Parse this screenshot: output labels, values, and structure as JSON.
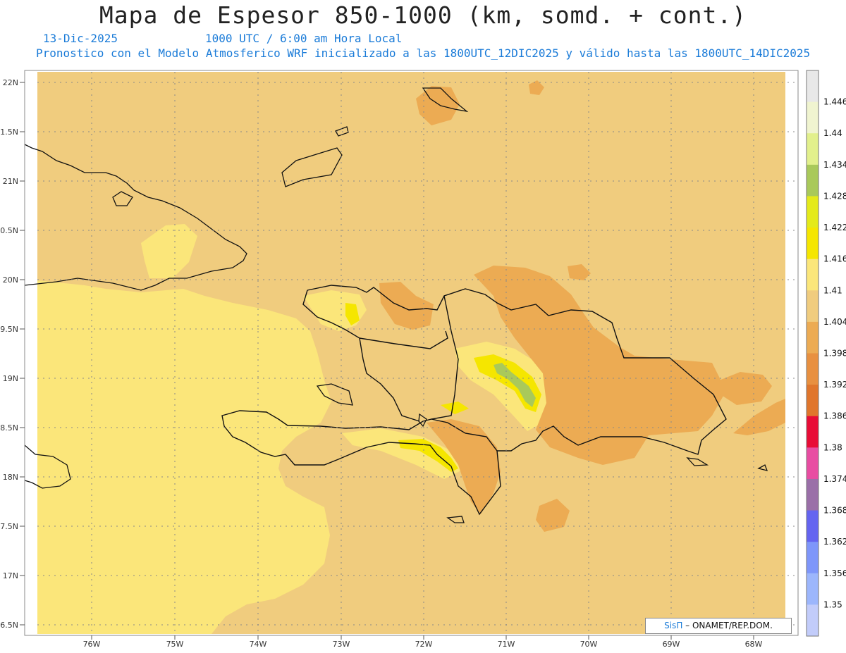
{
  "header": {
    "title": "Mapa de Espesor 850-1000 (km, somd. + cont.)",
    "date": "13-Dic-2025",
    "time": "1000 UTC / 6:00 am Hora Local",
    "forecast_line": "Pronostico con el Modelo Atmosferico WRF inicializado a las 1800UTC_12DIC2025 y válido hasta las  1800UTC_14DIC2025"
  },
  "axes": {
    "lat_labels": [
      "22N",
      "1.5N",
      "21N",
      "0.5N",
      "20N",
      "9.5N",
      "19N",
      "8.5N",
      "18N",
      "7.5N",
      "17N",
      "6.5N"
    ],
    "lon_labels": [
      "76W",
      "75W",
      "74W",
      "73W",
      "72W",
      "71W",
      "70W",
      "69W",
      "68W"
    ]
  },
  "colorbar": {
    "labels": [
      "1.446",
      "1.44",
      "1.434",
      "1.428",
      "1.422",
      "1.416",
      "1.41",
      "1.404",
      "1.398",
      "1.392",
      "1.386",
      "1.38",
      "1.374",
      "1.368",
      "1.362",
      "1.356",
      "1.35"
    ],
    "colors": [
      "#e8e8e8",
      "#f0f4d0",
      "#e2f08c",
      "#a9c95a",
      "#e4ea1a",
      "#f5e600",
      "#fbe67a",
      "#f0cc7e",
      "#ecab53",
      "#e89040",
      "#e0762c",
      "#e80c36",
      "#e84da2",
      "#9a6fa8",
      "#6464f0",
      "#7e96fa",
      "#9cb6fc",
      "#c2ccfa"
    ]
  },
  "credit": {
    "sis": "SisΠ",
    "rest": "– ONAMET/REP.DOM."
  }
}
